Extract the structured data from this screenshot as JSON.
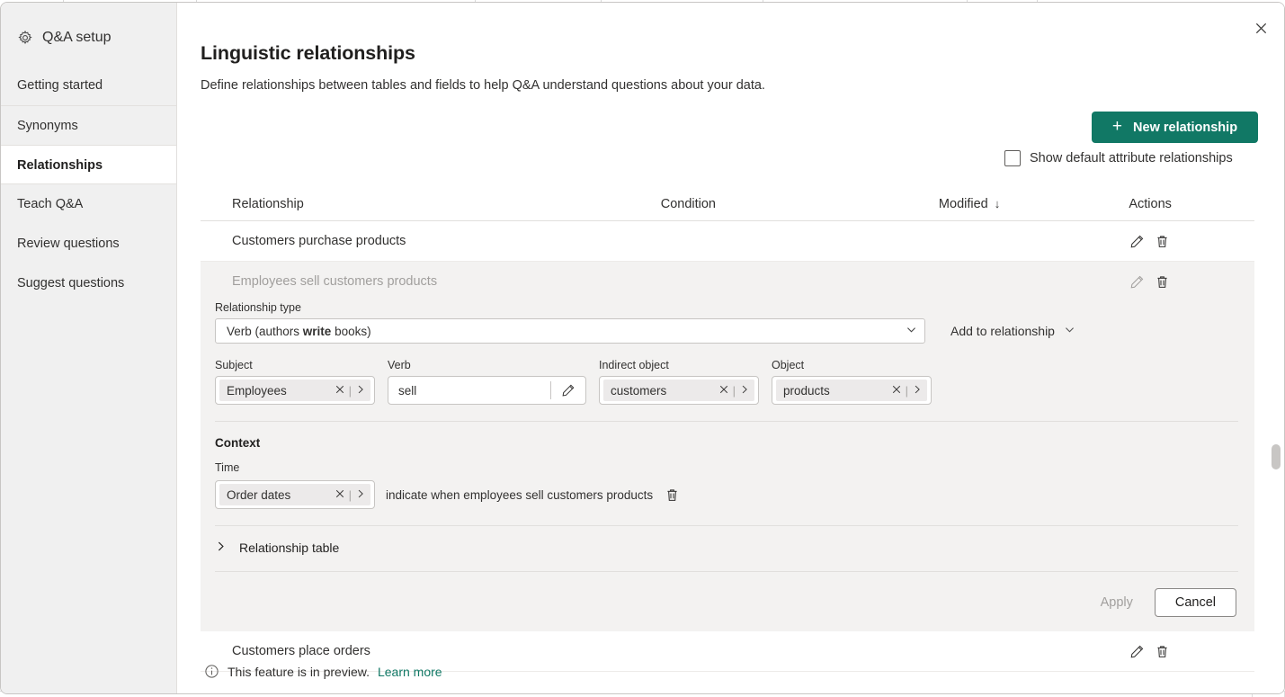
{
  "sidebar": {
    "title": "Q&A setup",
    "title_icon": "gear-icon",
    "items": [
      {
        "label": "Getting started",
        "selected": false
      },
      {
        "label": "Synonyms",
        "selected": false
      },
      {
        "label": "Relationships",
        "selected": true
      },
      {
        "label": "Teach Q&A",
        "selected": false
      },
      {
        "label": "Review questions",
        "selected": false
      },
      {
        "label": "Suggest questions",
        "selected": false
      }
    ]
  },
  "header": {
    "title": "Linguistic relationships",
    "subtitle": "Define relationships between tables and fields to help Q&A understand questions about your data.",
    "close_icon": "close-icon"
  },
  "toolbar": {
    "new_relationship_label": "New relationship",
    "new_relationship_icon": "plus-icon",
    "show_default_label": "Show default attribute relationships",
    "show_default_checked": false
  },
  "table": {
    "columns": [
      "Relationship",
      "Condition",
      "Modified",
      "Actions"
    ],
    "sort_column": "Modified",
    "sort_icon": "arrow-down-icon",
    "rows": [
      {
        "relationship": "Customers purchase products",
        "condition": "",
        "modified": "",
        "active": false
      },
      {
        "relationship": "Employees sell customers products",
        "condition": "",
        "modified": "",
        "active": true
      },
      {
        "relationship": "Customers place orders",
        "condition": "",
        "modified": "",
        "active": false
      }
    ],
    "row_actions": {
      "edit_icon": "pencil-icon",
      "delete_icon": "trash-icon"
    }
  },
  "edit_panel": {
    "relationship_type_label": "Relationship type",
    "relationship_type_value_prefix": "Verb (authors ",
    "relationship_type_value_bold": "write",
    "relationship_type_value_suffix": " books)",
    "relationship_type_chevron": "chevron-down-icon",
    "add_to_relationship_label": "Add to relationship",
    "add_to_relationship_chevron": "chevron-down-icon",
    "slots": [
      {
        "label": "Subject",
        "value": "Employees",
        "kind": "token"
      },
      {
        "label": "Verb",
        "value": "sell",
        "kind": "text",
        "edit_icon": "pencil-icon"
      },
      {
        "label": "Indirect object",
        "value": "customers",
        "kind": "token"
      },
      {
        "label": "Object",
        "value": "products",
        "kind": "token"
      }
    ],
    "token_clear_icon": "close-icon",
    "token_next_icon": "chevron-right-icon",
    "context_heading": "Context",
    "context": {
      "label": "Time",
      "value": "Order dates",
      "phrase": "indicate when employees sell customers products",
      "delete_icon": "trash-icon"
    },
    "relationship_table_expander_label": "Relationship table",
    "relationship_table_expander_icon": "chevron-right-icon",
    "apply_label": "Apply",
    "apply_disabled": true,
    "cancel_label": "Cancel"
  },
  "footer": {
    "info_icon": "info-icon",
    "text": "This feature is in preview.",
    "link_label": "Learn more"
  },
  "colors": {
    "accent_green": "#117865",
    "link_green": "#117865",
    "panel_background": "#f3f2f1",
    "sidebar_background": "#f0f0f0"
  }
}
